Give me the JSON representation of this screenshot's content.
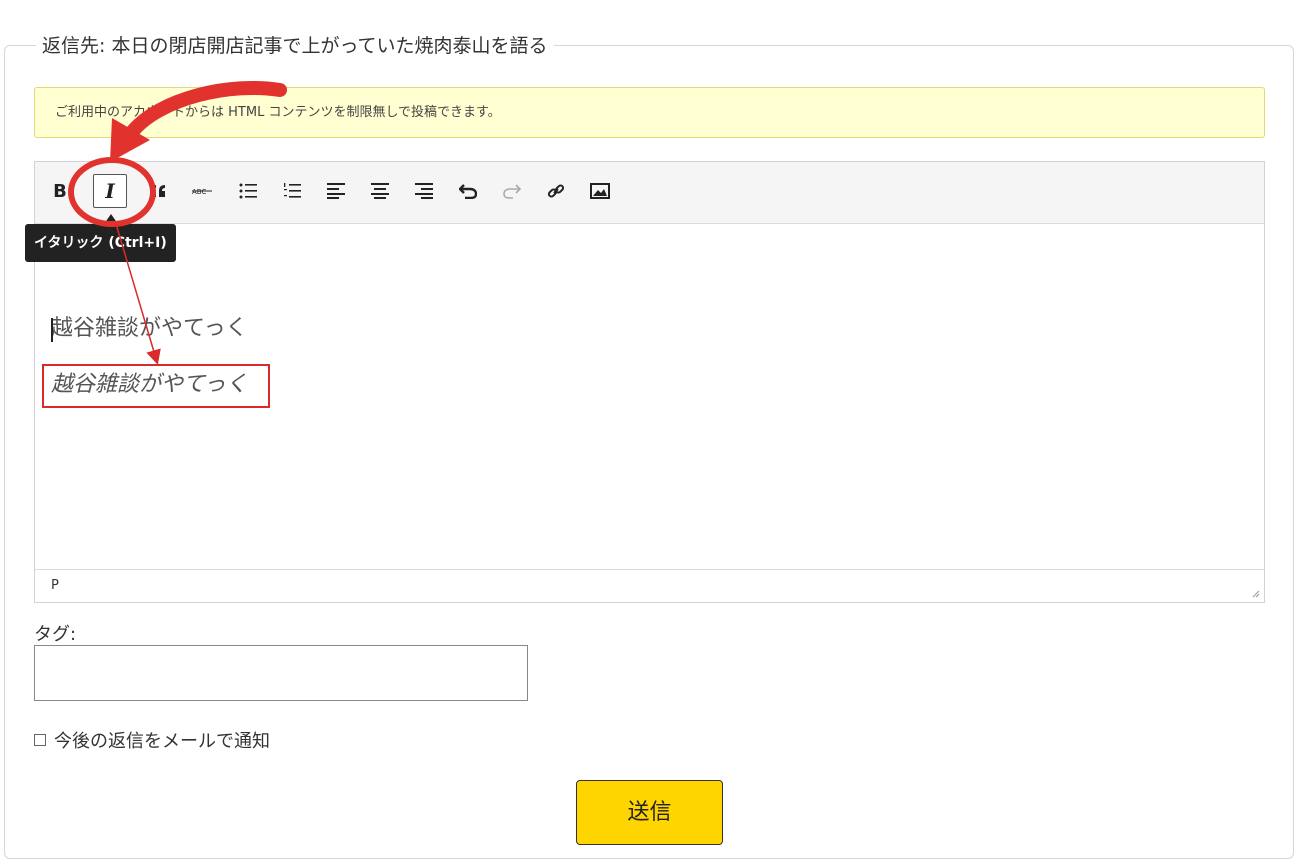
{
  "reply": {
    "legend": "返信先: 本日の閉店開店記事で上がっていた焼肉泰山を語る",
    "notice": "ご利用中のアカウントからは HTML コンテンツを制限無しで投稿できます。"
  },
  "toolbar": {
    "buttons": [
      {
        "name": "bold",
        "icon": "bold-icon"
      },
      {
        "name": "italic",
        "icon": "italic-icon",
        "active": true
      },
      {
        "name": "blockquote",
        "icon": "quote-icon"
      },
      {
        "name": "strikethrough",
        "icon": "strikethrough-icon"
      },
      {
        "name": "bulleted-list",
        "icon": "bulleted-list-icon"
      },
      {
        "name": "numbered-list",
        "icon": "numbered-list-icon"
      },
      {
        "name": "align-left",
        "icon": "align-left-icon"
      },
      {
        "name": "align-center",
        "icon": "align-center-icon"
      },
      {
        "name": "align-right",
        "icon": "align-right-icon"
      },
      {
        "name": "undo",
        "icon": "undo-icon"
      },
      {
        "name": "redo",
        "icon": "redo-icon",
        "disabled": true
      },
      {
        "name": "link",
        "icon": "link-icon"
      },
      {
        "name": "image",
        "icon": "image-icon"
      }
    ],
    "tooltip": "イタリック (Ctrl+I)"
  },
  "editor": {
    "line1": "越谷雑談がやてっく",
    "line2": "越谷雑談がやてっく",
    "status_path": "P"
  },
  "form": {
    "tag_label": "タグ:",
    "tag_value": "",
    "notify_label": "今後の返信をメールで通知",
    "notify_checked": false,
    "submit_label": "送信"
  },
  "colors": {
    "accent_button": "#ffd500",
    "notice_bg": "#ffffd2",
    "annotation_red": "#d92b2b"
  }
}
